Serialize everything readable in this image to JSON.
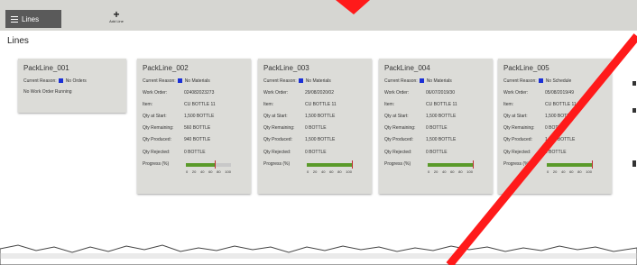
{
  "topbar": {
    "menu_label": "Lines",
    "add_line_label": "Add Line"
  },
  "page_title": "Lines",
  "labels": {
    "current_reason": "Current Reason:",
    "work_order": "Work Order:",
    "item": "Item:",
    "qty_at_start": "Qty at Start:",
    "qty_remaining": "Qty Remaining:",
    "qty_produced": "Qty Produced:",
    "qty_rejected": "Qty Rejected:",
    "progress": "Progress (%)"
  },
  "ticks": [
    "0",
    "20",
    "40",
    "60",
    "80",
    "100"
  ],
  "colors": {
    "reason_swatch": "#1a2fd6",
    "progress_fill": "#5a9a2a",
    "marker": "#c03030",
    "annotation_line": "#ff1a1a"
  },
  "cards": [
    {
      "name": "PackLine_001",
      "reason": "No Orders",
      "no_work_order": "No Work Order Running"
    },
    {
      "name": "PackLine_002",
      "reason": "No Materials",
      "work_order": "024082023273",
      "item": "CU BOTTLE 11",
      "qty_at_start": "1,500 BOTTLE",
      "qty_remaining": "560 BOTTLE",
      "qty_produced": "940 BOTTLE",
      "qty_rejected": "0 BOTTLE",
      "progress": 0.63
    },
    {
      "name": "PackLine_003",
      "reason": "No Materials",
      "work_order": "29/08/2020/02",
      "item": "CU BOTTLE 11",
      "qty_at_start": "1,500 BOTTLE",
      "qty_remaining": "0 BOTTLE",
      "qty_produced": "1,500 BOTTLE",
      "qty_rejected": "0 BOTTLE",
      "progress": 1.0
    },
    {
      "name": "PackLine_004",
      "reason": "No Materials",
      "work_order": "06/07/2019/30",
      "item": "CU BOTTLE 11",
      "qty_at_start": "1,500 BOTTLE",
      "qty_remaining": "0 BOTTLE",
      "qty_produced": "1,500 BOTTLE",
      "qty_rejected": "0 BOTTLE",
      "progress": 1.0
    },
    {
      "name": "PackLine_005",
      "reason": "No Schedule",
      "work_order": "05/08/2019/49",
      "item": "CU BOTTLE 11",
      "qty_at_start": "1,500 BOTTLE",
      "qty_remaining": "0 BOTTLE",
      "qty_produced": "1,500 BOTTLE",
      "qty_rejected": "0 BOTTLE",
      "progress": 1.0
    }
  ]
}
